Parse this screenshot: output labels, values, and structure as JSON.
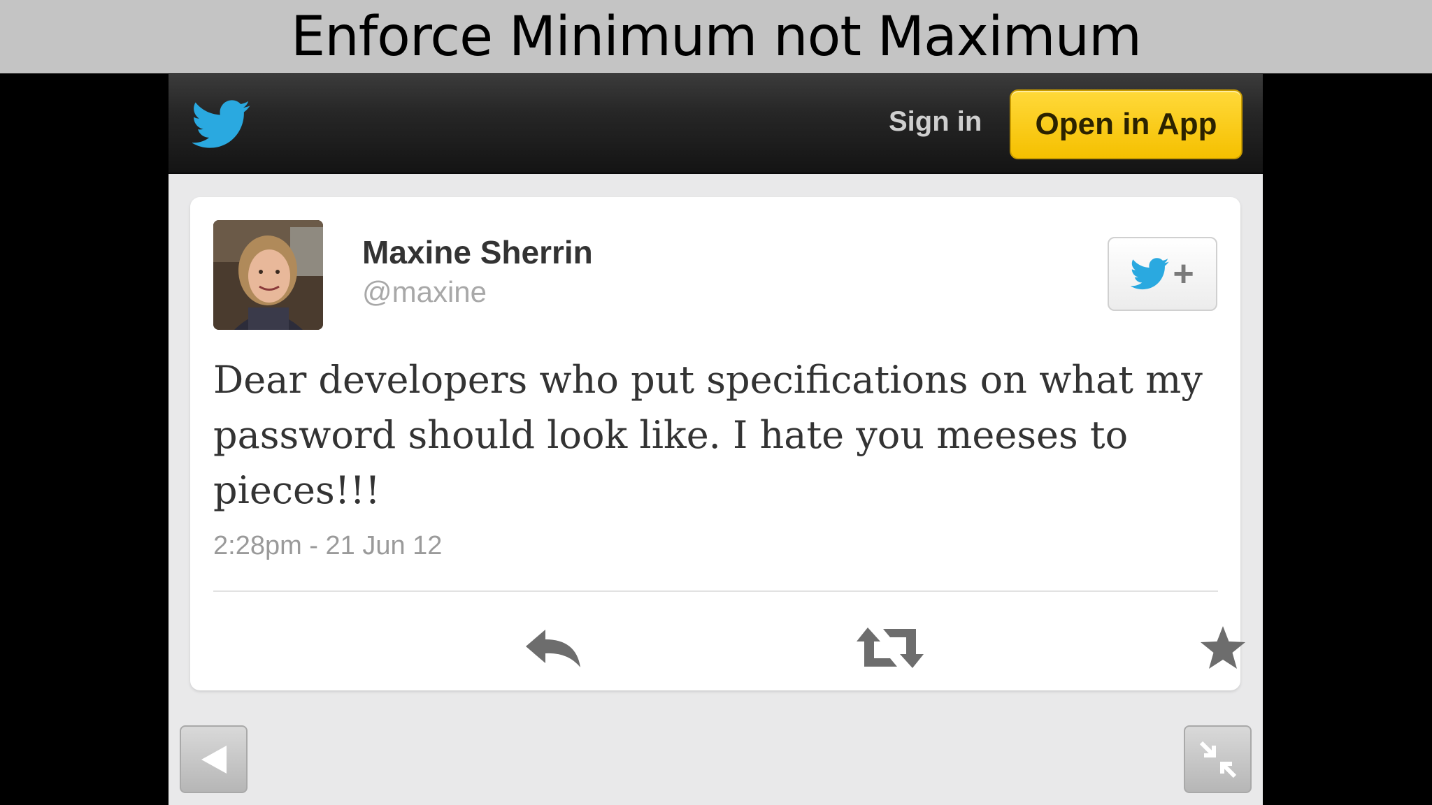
{
  "slide": {
    "title": "Enforce Minimum not Maximum"
  },
  "topbar": {
    "logo_icon": "twitter-bird-icon",
    "signin_label": "Sign in",
    "open_app_label": "Open in App",
    "accent_color": "#f5c000"
  },
  "tweet": {
    "author_name": "Maxine Sherrin",
    "author_handle": "@maxine",
    "text": "Dear developers who put specifications on what my password should look like. I hate you meeses to pieces!!!",
    "timestamp": "2:28pm - 21 Jun 12",
    "follow_button": {
      "icons": [
        "twitter-bird-icon",
        "plus-icon"
      ],
      "label": "+"
    },
    "actions": [
      {
        "name": "reply",
        "icon": "reply-icon"
      },
      {
        "name": "retweet",
        "icon": "retweet-icon"
      },
      {
        "name": "favorite",
        "icon": "star-icon"
      }
    ]
  },
  "bottom_nav": {
    "back_icon": "back-triangle-icon",
    "collapse_icon": "collapse-arrows-icon"
  },
  "colors": {
    "twitter_blue": "#2aa9e0",
    "open_app_yellow": "#f5c000"
  }
}
